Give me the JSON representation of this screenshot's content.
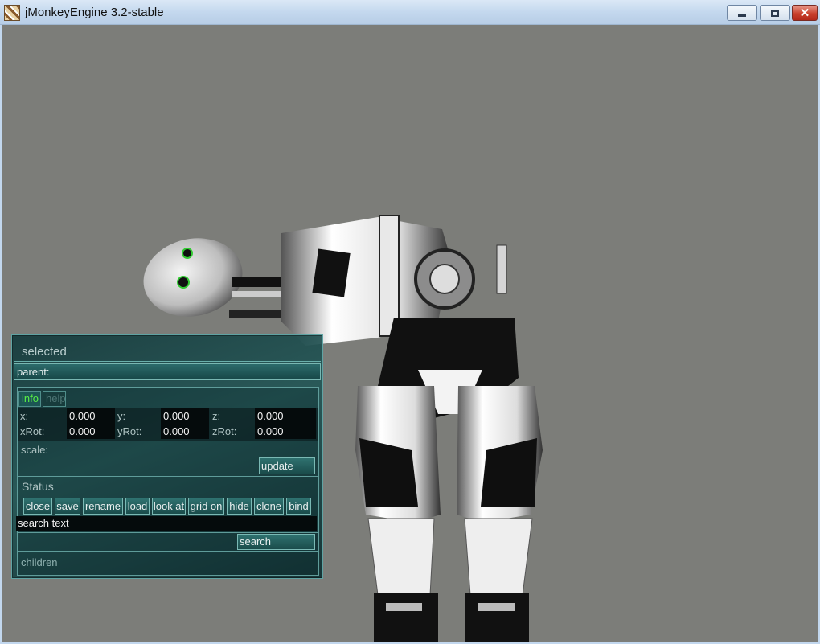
{
  "window": {
    "title": "jMonkeyEngine 3.2-stable",
    "icon": "jmonkey-app-icon",
    "controls": {
      "minimize_icon": "minimize-icon",
      "maximize_icon": "maximize-icon",
      "close_glyph": "✕"
    }
  },
  "viewport": {
    "background": "#7c7d79",
    "scene_object": "humanoid robot model"
  },
  "panel": {
    "title": "selected",
    "parent_label": "parent:",
    "tabs": [
      {
        "label": "info",
        "active": true,
        "color": "#59f046"
      },
      {
        "label": "help",
        "active": false
      }
    ],
    "coords": {
      "x_label": "x:",
      "x_value": "0.000",
      "y_label": "y:",
      "y_value": "0.000",
      "z_label": "z:",
      "z_value": "0.000",
      "xrot_label": "xRot:",
      "xrot_value": "0.000",
      "yrot_label": "yRot:",
      "yrot_value": "0.000",
      "zrot_label": "zRot:",
      "zrot_value": "0.000"
    },
    "scale_label": "scale:",
    "update_label": "update",
    "status_label": "Status",
    "actions": [
      {
        "id": "close",
        "label": "close"
      },
      {
        "id": "save",
        "label": "save"
      },
      {
        "id": "rename",
        "label": "rename"
      },
      {
        "id": "load",
        "label": "load"
      },
      {
        "id": "look-at",
        "label": "look at"
      },
      {
        "id": "grid-on",
        "label": "grid on"
      },
      {
        "id": "hide",
        "label": "hide"
      },
      {
        "id": "clone",
        "label": "clone"
      },
      {
        "id": "bind",
        "label": "bind"
      }
    ],
    "search_value": "search text",
    "search_label": "search",
    "children_label": "children"
  }
}
